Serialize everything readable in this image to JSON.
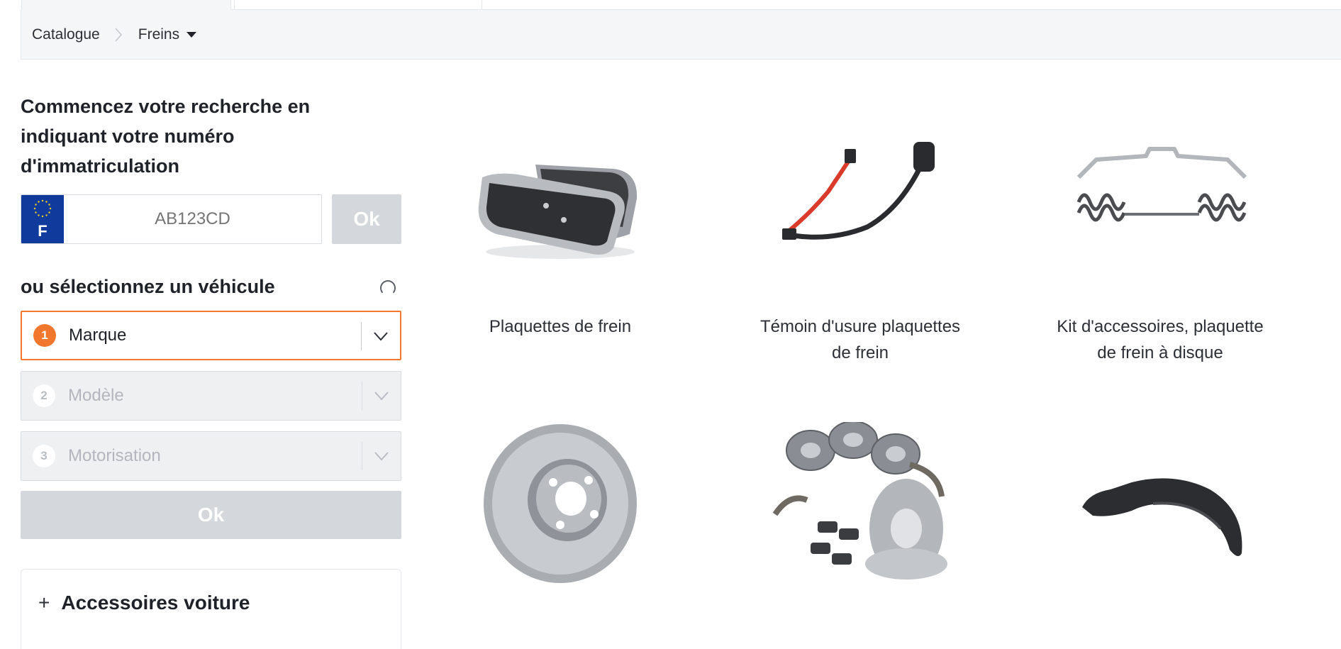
{
  "breadcrumb": {
    "items": [
      "Catalogue",
      "Freins"
    ]
  },
  "search": {
    "title": "Commencez votre recherche en indiquant votre numéro d'immatriculation",
    "plate_country": "F",
    "plate_placeholder": "AB123CD",
    "ok_label": "Ok"
  },
  "vehicle": {
    "title": "ou sélectionnez un véhicule",
    "selects": [
      {
        "step": "1",
        "label": "Marque",
        "state": "active"
      },
      {
        "step": "2",
        "label": "Modèle",
        "state": "disabled"
      },
      {
        "step": "3",
        "label": "Motorisation",
        "state": "disabled"
      }
    ],
    "ok_label": "Ok"
  },
  "accessories": {
    "label": "Accessoires voiture"
  },
  "products": [
    {
      "name": "Plaquettes de frein",
      "icon": "brake-pads-image"
    },
    {
      "name": "Témoin d'usure plaquettes de frein",
      "icon": "wear-sensor-image"
    },
    {
      "name": "Kit d'accessoires, plaquette de frein à disque",
      "icon": "accessory-kit-image"
    },
    {
      "name": "",
      "icon": "brake-disc-image"
    },
    {
      "name": "",
      "icon": "brake-set-image"
    },
    {
      "name": "",
      "icon": "splash-panel-image"
    }
  ],
  "colors": {
    "accent": "#f0772d",
    "plate_blue": "#103a9c",
    "disabled_button": "#d4d7db"
  }
}
